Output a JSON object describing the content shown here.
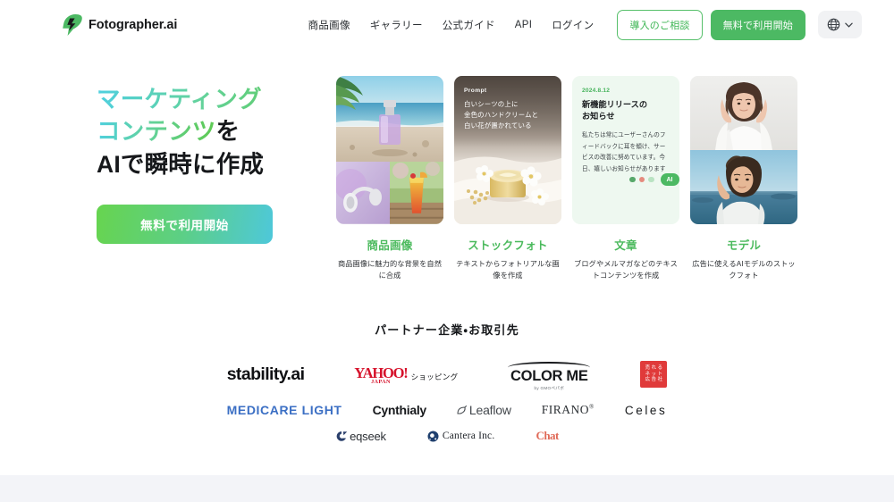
{
  "header": {
    "brand": "Fotographer.ai",
    "brand_icon": "bolt-logo-icon",
    "nav_links": [
      {
        "label": "商品画像"
      },
      {
        "label": "ギャラリー"
      },
      {
        "label": "公式ガイド"
      },
      {
        "label": "API"
      },
      {
        "label": "ログイン"
      }
    ],
    "consult_button": "導入のご相談",
    "start_button": "無料で利用開始",
    "language_icon": "globe-icon",
    "language_chevron": "chevron-down-icon"
  },
  "hero": {
    "title_line1": "マーケティング",
    "title_line2_grad": "コンテンツ",
    "title_line2_dark": "を",
    "title_line3": "AIで瞬時に作成",
    "cta": "無料で利用開始"
  },
  "cards": [
    {
      "id": "product-image",
      "title": "商品画像",
      "desc": "商品画像に魅力的な背景を自然に合成"
    },
    {
      "id": "stock-photo",
      "title": "ストックフォト",
      "desc": "テキストからフォトリアルな画像を作成",
      "prompt_label": "Prompt",
      "prompt_text": "白いシーツの上に\n金色のハンドクリームと\n白い花が置かれている"
    },
    {
      "id": "text",
      "title": "文章",
      "desc": "ブログやメルマガなどのテキストコンテンツを作成",
      "note_date": "2024.8.12",
      "note_head": "新機能リリースの\nお知らせ",
      "note_body": "私たちは常にユーザーさんのフィードバックに耳を傾け、サービスの改善に努めています。今日、嬉しいお知らせがあります",
      "note_badge": "AI"
    },
    {
      "id": "model",
      "title": "モデル",
      "desc": "広告に使えるAIモデルのストックフォト"
    }
  ],
  "partners": {
    "title": "パートナー企業・お取引先",
    "row1": [
      {
        "id": "stability-ai",
        "name": "stability.ai"
      },
      {
        "id": "yahoo-japan-shopping",
        "top": "YAHOO!",
        "sub": "JAPAN",
        "jp": "ショッピング"
      },
      {
        "id": "color-me",
        "name": "COLOR ME",
        "sub": "by GMOペパボ"
      },
      {
        "id": "urenet",
        "cells": [
          "売",
          "れ",
          "る",
          "ネ",
          "ッ",
          "ト",
          "広",
          "告",
          "社"
        ]
      }
    ],
    "row2": [
      {
        "id": "medicare-light",
        "name": "MEDICARE LIGHT"
      },
      {
        "id": "cynthialy",
        "name": "Cynthialy"
      },
      {
        "id": "leaflow",
        "name": "Leaflow",
        "icon": "leaf-icon"
      },
      {
        "id": "firano",
        "name": "FIRANO",
        "mark": "®"
      },
      {
        "id": "celes",
        "name": "Celes"
      }
    ],
    "row3": [
      {
        "id": "eqseek",
        "name": "eqseek",
        "icon": "eqseek-mark-icon"
      },
      {
        "id": "cantera",
        "name": "Cantera Inc.",
        "icon": "cantera-mark-icon"
      },
      {
        "id": "chat-logo",
        "name": "Chat"
      }
    ]
  },
  "colors": {
    "brand_green": "#4cb963",
    "accent_cyan": "#4ec8da",
    "note_bg": "#eef8f0",
    "footer": "#f3f4f8"
  }
}
